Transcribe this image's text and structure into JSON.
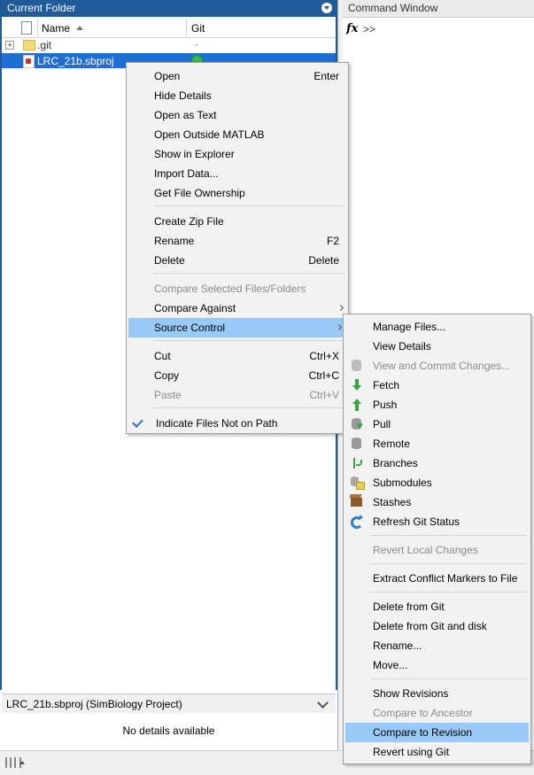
{
  "current_folder": {
    "title": "Current Folder",
    "columns": {
      "name": "Name",
      "git": "Git"
    },
    "rows": [
      {
        "name": ".git",
        "git": "·"
      },
      {
        "name": "LRC_21b.sbproj"
      }
    ],
    "details_header": "LRC_21b.sbproj  (SimBiology Project)",
    "details_body": "No details available"
  },
  "command_window": {
    "title": "Command Window",
    "fx": "fx",
    "prompt": ">>"
  },
  "context_menu": {
    "items": [
      {
        "label": "Open",
        "shortcut": "Enter"
      },
      {
        "label": "Hide Details"
      },
      {
        "label": "Open as Text"
      },
      {
        "label": "Open Outside MATLAB"
      },
      {
        "label": "Show in Explorer"
      },
      {
        "label": "Import Data..."
      },
      {
        "label": "Get File Ownership"
      },
      {
        "label": "Create Zip File"
      },
      {
        "label": "Rename",
        "shortcut": "F2"
      },
      {
        "label": "Delete",
        "shortcut": "Delete"
      },
      {
        "label": "Compare Selected Files/Folders"
      },
      {
        "label": "Compare Against"
      },
      {
        "label": "Source Control"
      },
      {
        "label": "Cut",
        "shortcut": "Ctrl+X"
      },
      {
        "label": "Copy",
        "shortcut": "Ctrl+C"
      },
      {
        "label": "Paste",
        "shortcut": "Ctrl+V"
      },
      {
        "label": "Indicate Files Not on Path"
      }
    ]
  },
  "source_control_menu": {
    "items": [
      {
        "label": "Manage Files..."
      },
      {
        "label": "View Details"
      },
      {
        "label": "View and Commit Changes...",
        "icon": "commit-icon"
      },
      {
        "label": "Fetch",
        "icon": "fetch-icon"
      },
      {
        "label": "Push",
        "icon": "push-icon"
      },
      {
        "label": "Pull",
        "icon": "pull-icon"
      },
      {
        "label": "Remote",
        "icon": "remote-icon"
      },
      {
        "label": "Branches",
        "icon": "branches-icon"
      },
      {
        "label": "Submodules",
        "icon": "submodules-icon"
      },
      {
        "label": "Stashes",
        "icon": "stashes-icon"
      },
      {
        "label": "Refresh Git Status",
        "icon": "refresh-icon"
      },
      {
        "label": "Revert Local Changes"
      },
      {
        "label": "Extract Conflict Markers to File"
      },
      {
        "label": "Delete from Git"
      },
      {
        "label": "Delete from Git and disk"
      },
      {
        "label": "Rename..."
      },
      {
        "label": "Move..."
      },
      {
        "label": "Show Revisions"
      },
      {
        "label": "Compare to Ancestor"
      },
      {
        "label": "Compare to Revision"
      },
      {
        "label": "Revert using Git"
      }
    ]
  },
  "colors": {
    "title_bar": "#1f5a9a",
    "selection": "#1f6fd0",
    "menu_highlight": "#99c9f7",
    "git_status_ok": "#39b54a"
  }
}
